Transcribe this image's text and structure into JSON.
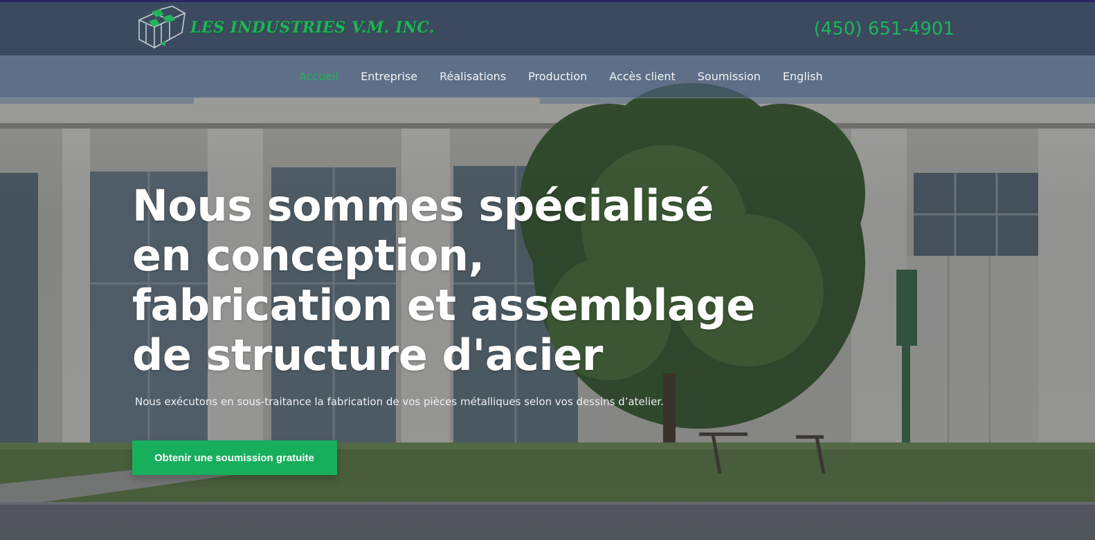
{
  "brand": {
    "name": "LES INDUSTRIES V.M. INC.",
    "phone": "(450) 651-4901"
  },
  "nav": {
    "items": [
      {
        "label": "Accueil",
        "active": true
      },
      {
        "label": "Entreprise",
        "active": false
      },
      {
        "label": "Réalisations",
        "active": false
      },
      {
        "label": "Production",
        "active": false
      },
      {
        "label": "Accès client",
        "active": false
      },
      {
        "label": "Soumission",
        "active": false
      },
      {
        "label": "English",
        "active": false
      }
    ]
  },
  "hero": {
    "title": "Nous sommes spécialisé en conception, fabrication et assemblage de structure d'acier",
    "subtitle": "Nous exécutons en sous-traitance la fabrication de vos pièces métalliques selon vos dessins d’atelier.",
    "cta_label": "Obtenir une soumission gratuite"
  },
  "colors": {
    "accent": "#17ae5c",
    "topbar": "#3b4a5e",
    "nav_bg": "#4e6282"
  },
  "icons": {
    "logo": "logo-icon"
  }
}
